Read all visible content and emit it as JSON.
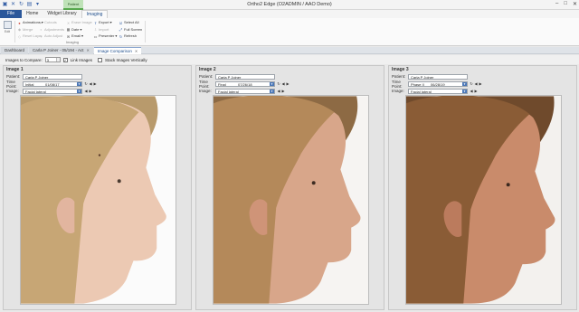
{
  "window": {
    "title": "Ortho2 Edge (O2ADMIN / AAO Demo)",
    "context_tab": "Patient"
  },
  "ribbon_tabs": [
    "File",
    "Home",
    "Widget Library",
    "Imaging"
  ],
  "ribbon": {
    "big_button": "Edit",
    "col1": [
      {
        "label": "Animations",
        "enabled": true
      },
      {
        "label": "Merge",
        "enabled": false
      },
      {
        "label": "Reset Layer",
        "enabled": false
      }
    ],
    "col2": [
      {
        "label": "Cutouts",
        "enabled": false
      },
      {
        "label": "Adjustments",
        "enabled": false
      },
      {
        "label": "Auto Adjust",
        "enabled": false
      }
    ],
    "col3": [
      {
        "label": "Erase Image",
        "enabled": false
      },
      {
        "label": "Date",
        "enabled": true
      },
      {
        "label": "Email",
        "enabled": true
      }
    ],
    "col4": [
      {
        "label": "Export",
        "enabled": true
      },
      {
        "label": "Import",
        "enabled": false
      },
      {
        "label": "Presenter",
        "enabled": true
      }
    ],
    "col5": [
      {
        "label": "Select All",
        "enabled": true
      },
      {
        "label": "Full Screen",
        "enabled": true
      },
      {
        "label": "Refresh",
        "enabled": true
      }
    ],
    "group_label": "Imaging"
  },
  "doc_tabs": [
    {
      "label": "Dashboard",
      "active": false
    },
    {
      "label": "Carla P Joiner - 05/194 - Act",
      "active": false
    },
    {
      "label": "Image Comparison",
      "active": true
    }
  ],
  "options": {
    "images_to_compare_label": "Images to Compare:",
    "images_to_compare_value": "3",
    "link_images_label": "Link Images",
    "link_images_checked": true,
    "stack_vertically_label": "Stack Images Vertically",
    "stack_vertically_checked": false
  },
  "labels": {
    "patient": "Patient:",
    "time_point": "Time Point:",
    "image": "Image:"
  },
  "panels": [
    {
      "heading": "Image 1",
      "patient": "Carla P Joiner",
      "time_point_name": "Initial",
      "time_point_date": "01/08/17",
      "image": "Facial lateral"
    },
    {
      "heading": "Image 2",
      "patient": "Carla P Joiner",
      "time_point_name": "Final",
      "time_point_date": "07/26/18",
      "image": "Facial lateral"
    },
    {
      "heading": "Image 3",
      "patient": "Carla P Joiner",
      "time_point_name": "Phase II",
      "time_point_date": "06/28/19",
      "image": "Facial lateral"
    }
  ],
  "colors": {
    "file_tab": "#2b579a",
    "accent": "#1f4e8c",
    "context_tab": "#bfe2b8"
  }
}
